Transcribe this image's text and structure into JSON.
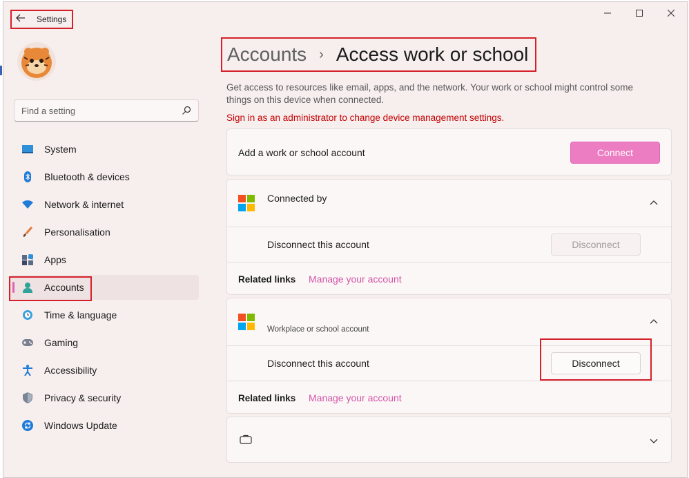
{
  "titlebar": {
    "back_icon": "back-arrow-icon",
    "app_title": "Settings",
    "minimize_icon": "minimize-icon",
    "maximize_icon": "maximize-icon",
    "close_icon": "close-icon"
  },
  "search": {
    "placeholder": "Find a setting",
    "icon": "search-icon"
  },
  "sidebar": {
    "items": [
      {
        "label": "System",
        "icon": "monitor-icon"
      },
      {
        "label": "Bluetooth & devices",
        "icon": "bluetooth-icon"
      },
      {
        "label": "Network & internet",
        "icon": "wifi-icon"
      },
      {
        "label": "Personalisation",
        "icon": "brush-icon"
      },
      {
        "label": "Apps",
        "icon": "apps-icon"
      },
      {
        "label": "Accounts",
        "icon": "person-icon",
        "active": true
      },
      {
        "label": "Time & language",
        "icon": "clock-globe-icon"
      },
      {
        "label": "Gaming",
        "icon": "gamepad-icon"
      },
      {
        "label": "Accessibility",
        "icon": "accessibility-icon"
      },
      {
        "label": "Privacy & security",
        "icon": "shield-icon"
      },
      {
        "label": "Windows Update",
        "icon": "update-icon"
      }
    ]
  },
  "breadcrumb": {
    "parent": "Accounts",
    "separator": "›",
    "title": "Access work or school"
  },
  "description": "Get access to resources like email, apps, and the network. Your work or school might control some things on this device when connected.",
  "warning": "Sign in as an administrator to change device management settings.",
  "add_account": {
    "label": "Add a work or school account",
    "button": "Connect"
  },
  "account1": {
    "name": "Connected by",
    "subtitle": "",
    "disconnect_label": "Disconnect this account",
    "disconnect_button": "Disconnect",
    "related_label": "Related links",
    "related_link": "Manage your account"
  },
  "account2": {
    "name": "",
    "subtitle": "Workplace or school account",
    "disconnect_label": "Disconnect this account",
    "disconnect_button": "Disconnect",
    "related_label": "Related links",
    "related_link": "Manage your account"
  },
  "account3": {
    "icon": "briefcase-icon"
  },
  "colors": {
    "accent": "#e461b8",
    "connect_button": "#ec7dc3",
    "link": "#d454a6",
    "warning": "#c40000",
    "highlight_box": "#d5202a",
    "window_bg": "#f7eeee"
  }
}
